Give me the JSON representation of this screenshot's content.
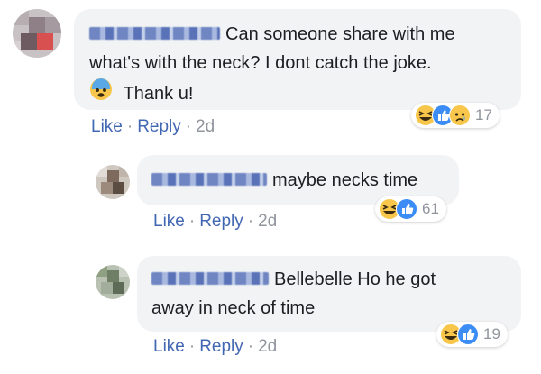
{
  "comments": [
    {
      "text_line1": "Can someone share with me",
      "text_line2": "what's with the neck? I dont catch the joke.",
      "text_line3": "Thank u!",
      "emoji": "anxious-face-icon",
      "actions": {
        "like": "Like",
        "reply": "Reply",
        "time": "2d"
      },
      "reactions": {
        "icons": [
          "haha-icon",
          "like-icon",
          "sad-icon"
        ],
        "count": "17"
      }
    },
    {
      "text_line1": "maybe necks time",
      "actions": {
        "like": "Like",
        "reply": "Reply",
        "time": "2d"
      },
      "reactions": {
        "icons": [
          "haha-icon",
          "like-icon"
        ],
        "count": "61"
      }
    },
    {
      "text_line1": "Bellebelle Ho he got",
      "text_line2": "away in neck of time",
      "actions": {
        "like": "Like",
        "reply": "Reply",
        "time": "2d"
      },
      "reactions": {
        "icons": [
          "haha-icon",
          "like-icon"
        ],
        "count": "19"
      }
    }
  ],
  "separator": "·",
  "colors": {
    "link": "#4267b2",
    "meta": "#90949c",
    "bubble": "#f2f3f5",
    "like_blue": "#3b8cf5",
    "haha_yellow": "#f7c64a"
  }
}
